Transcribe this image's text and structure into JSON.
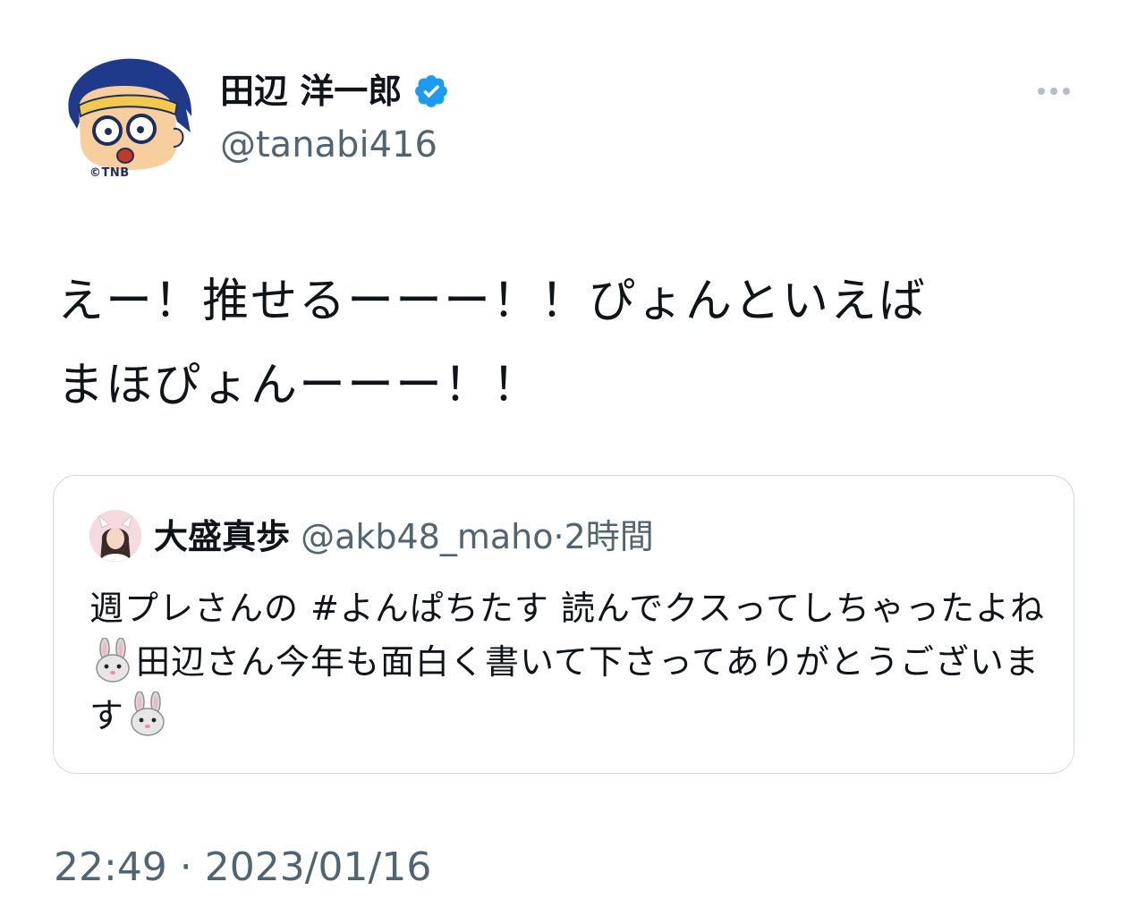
{
  "author": {
    "display_name": "田辺 洋一郎",
    "handle": "@tanabi416",
    "avatar_mark": "©TNB",
    "verified_icon": "verified-badge-icon"
  },
  "more_icon": "ellipsis-icon",
  "tweet": {
    "line1": "えー！推せるーーー！！ぴょんといえば",
    "line2": "まほぴょんーーー！！",
    "timestamp": "22:49 · 2023/01/16"
  },
  "quote": {
    "name": "大盛真歩",
    "handle": "@akb48_maho",
    "separator": "·",
    "time": "2時間",
    "text_part1": "週プレさんの #よんぱちたす 読んでクスってしちゃったよね",
    "text_part2": "田辺さん今年も面白く書いて下さってありがとうございます",
    "emoji_icon": "rabbit-face-icon"
  },
  "colors": {
    "text_primary": "#0f1419",
    "text_secondary": "#536471",
    "verified": "#1d9bf0",
    "border": "#cfd9de"
  }
}
